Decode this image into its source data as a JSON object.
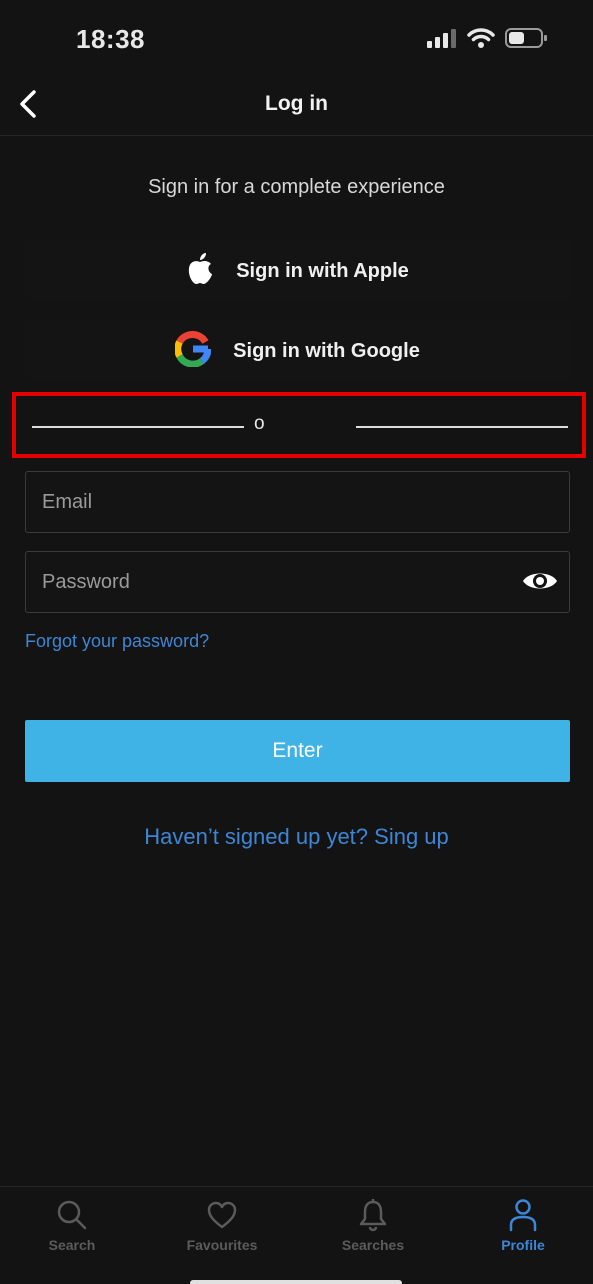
{
  "status_bar": {
    "time": "18:38"
  },
  "header": {
    "title": "Log in"
  },
  "subtitle": "Sign in for a complete experience",
  "social": {
    "apple_label": "Sign in with Apple",
    "google_label": "Sign in with Google"
  },
  "divider": {
    "text": "o"
  },
  "form": {
    "email_placeholder": "Email",
    "email_value": "",
    "password_placeholder": "Password",
    "password_value": "",
    "forgot_label": "Forgot your password?",
    "enter_label": "Enter",
    "signup_label": "Haven’t signed up yet? Sing up"
  },
  "tabs": [
    {
      "label": "Search",
      "icon": "search-icon",
      "active": false
    },
    {
      "label": "Favourites",
      "icon": "heart-icon",
      "active": false
    },
    {
      "label": "Searches",
      "icon": "bell-icon",
      "active": false
    },
    {
      "label": "Profile",
      "icon": "user-icon",
      "active": true
    }
  ],
  "colors": {
    "background": "#131313",
    "accent": "#40b3e6",
    "link": "#3d86d6",
    "highlight": "#e50000"
  }
}
